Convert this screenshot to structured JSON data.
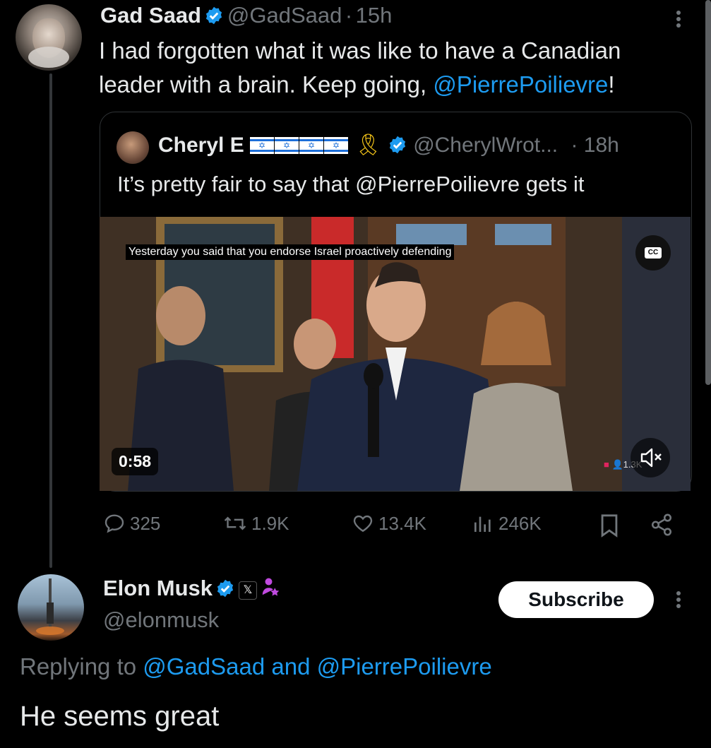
{
  "tweet": {
    "author_name": "Gad Saad",
    "author_handle": "@GadSaad",
    "separator": "·",
    "time": "15h",
    "text_line1": "I had forgotten what it was like to have a Canadian",
    "text_line2_prefix": "leader with a brain.  Keep going, ",
    "text_mention": "@PierrePoilievre",
    "text_suffix": "!"
  },
  "quote": {
    "author_name": "Cheryl E",
    "author_handle": "@CherylWrot...",
    "time": "· 18h",
    "text": "It’s pretty fair to say that @PierrePoilievre gets it",
    "video": {
      "caption": "Yesterday you said that you endorse Israel proactively defending",
      "cc_label": "CC",
      "duration": "0:58",
      "viewers": "1.3K"
    }
  },
  "actions": {
    "replies": "325",
    "reposts": "1.9K",
    "likes": "13.4K",
    "views": "246K"
  },
  "reply": {
    "author_name": "Elon Musk",
    "author_handle": "@elonmusk",
    "x_badge": "𝕏",
    "subscribe_label": "Subscribe",
    "replying_prefix": "Replying to ",
    "replying_users": "@GadSaad and @PierrePoilievre",
    "text": "He seems great"
  },
  "colors": {
    "background": "#000000",
    "text": "#e7e9ea",
    "muted": "#71767b",
    "accent": "#1d9bf0"
  }
}
